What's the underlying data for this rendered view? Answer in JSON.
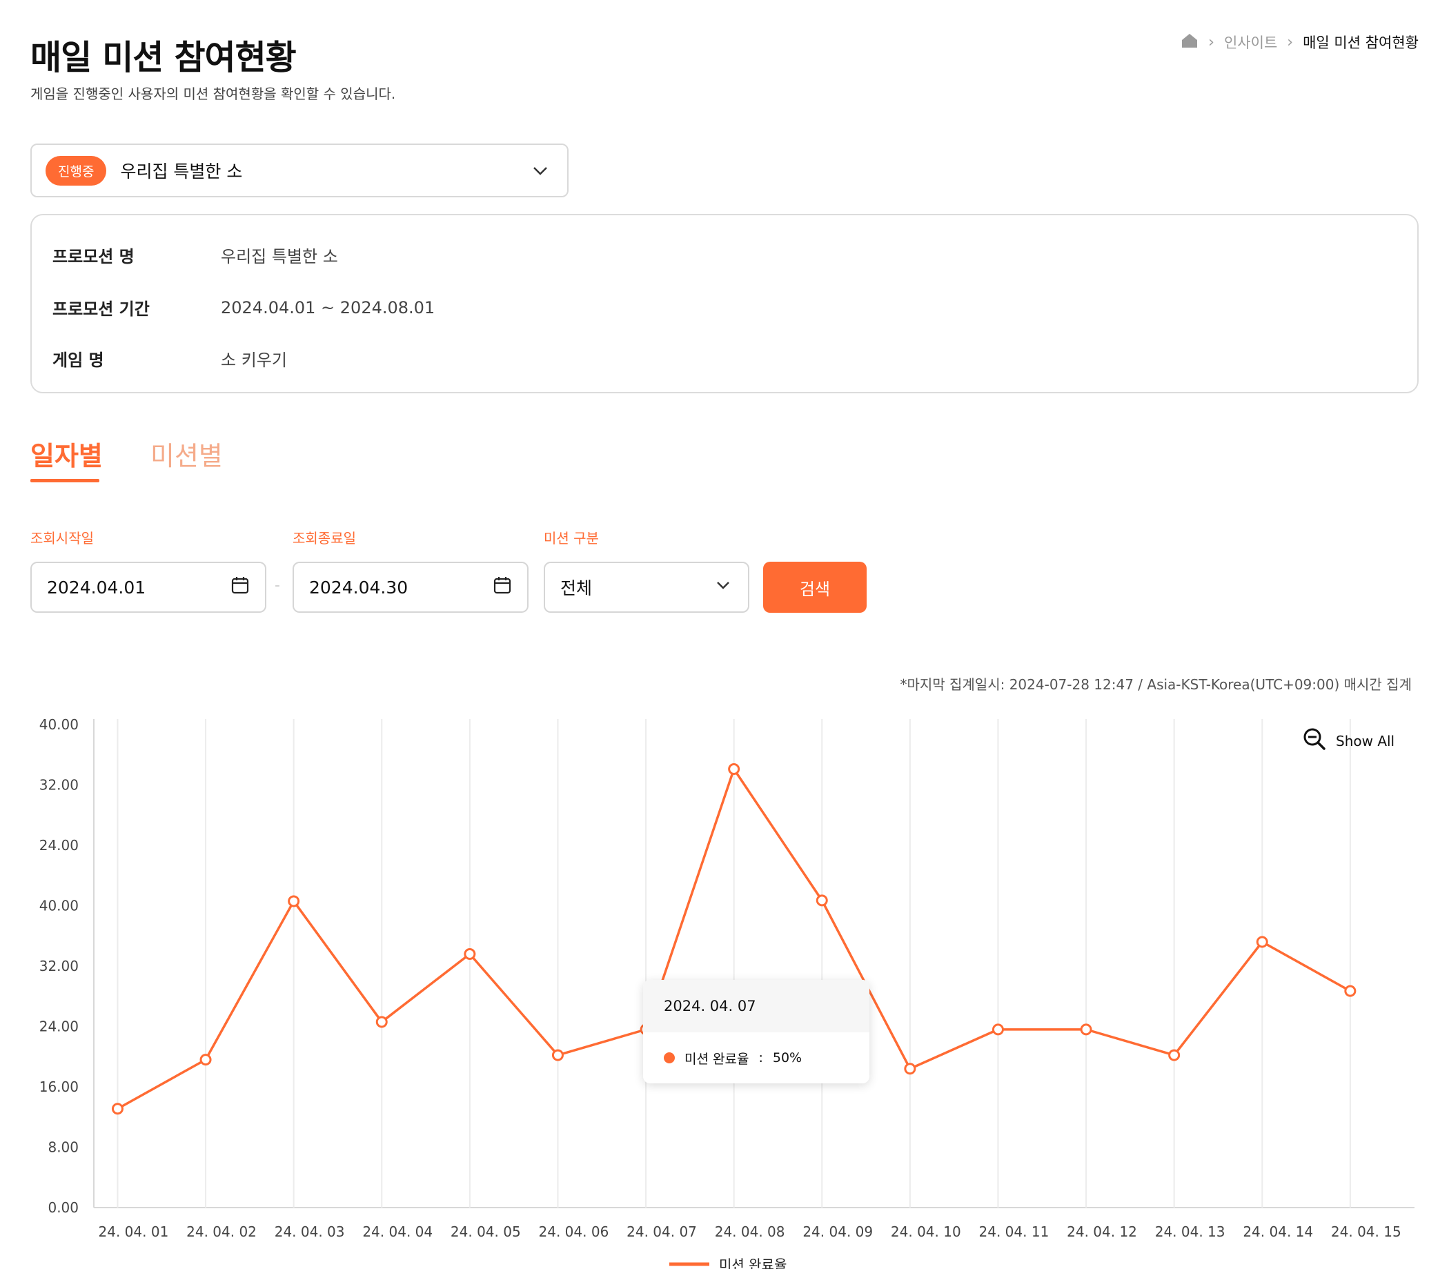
{
  "page": {
    "title": "매일 미션 참여현황",
    "subtitle": "게임을 진행중인 사용자의 미션 참여현황을 확인할 수 있습니다."
  },
  "breadcrumb": {
    "items": [
      "인사이트",
      "매일 미션 참여현황"
    ],
    "home_icon": "home-icon"
  },
  "promotion_select": {
    "status": "진행중",
    "value": "우리집 특별한 소"
  },
  "info": {
    "rows": [
      {
        "label": "프로모션 명",
        "value": "우리집 특별한 소"
      },
      {
        "label": "프로모션 기간",
        "value": "2024.04.01 ~ 2024.08.01"
      },
      {
        "label": "게임 명",
        "value": "소 키우기"
      }
    ]
  },
  "tabs": [
    {
      "label": "일자별",
      "active": true
    },
    {
      "label": "미션별",
      "active": false
    }
  ],
  "filters": {
    "start_label": "조회시작일",
    "start_value": "2024.04.01",
    "end_label": "조회종료일",
    "end_value": "2024.04.30",
    "mission_label": "미션 구분",
    "mission_value": "전체",
    "search_button": "검색",
    "separator": "-"
  },
  "note": "*마지막 집계일시: 2024-07-28 12:47 / Asia-KST-Korea(UTC+09:00) 매시간 집계",
  "show_all": "Show All",
  "tooltip": {
    "date": "2024. 04. 07",
    "series": "미션 완료율",
    "value": "50%"
  },
  "colors": {
    "accent": "#ff6b33",
    "accent_light": "#f5ab8a",
    "grid": "#ececec"
  },
  "chart_data": {
    "type": "line",
    "y_tick_labels": [
      "40.00",
      "32.00",
      "24.00",
      "40.00",
      "32.00",
      "24.00",
      "16.00",
      "8.00",
      "0.00"
    ],
    "categories": [
      "24. 04. 01",
      "24. 04. 02",
      "24. 04. 03",
      "24. 04. 04",
      "24. 04. 05",
      "24. 04. 06",
      "24. 04. 07",
      "24. 04. 08",
      "24. 04. 09",
      "24. 04. 10",
      "24. 04. 11",
      "24. 04. 12",
      "24. 04. 13",
      "24. 04. 14",
      "24. 04. 15"
    ],
    "series": [
      {
        "name": "미션 완료율",
        "values": [
          13.1,
          19.6,
          40.6,
          24.6,
          33.6,
          20.2,
          23.6,
          58.1,
          40.7,
          18.4,
          23.6,
          23.6,
          20.2,
          35.2,
          28.7
        ]
      }
    ],
    "ylim": [
      0,
      64
    ],
    "grid": "vertical",
    "legend": "bottom-center"
  }
}
